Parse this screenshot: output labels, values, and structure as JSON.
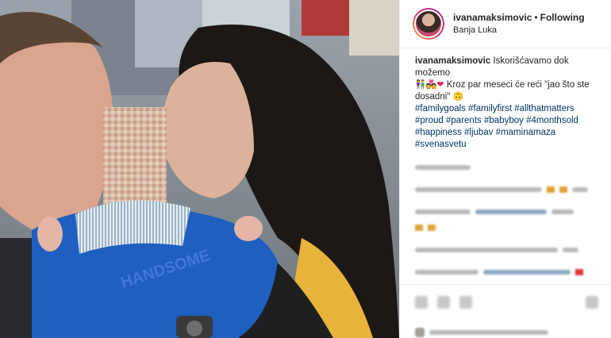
{
  "header": {
    "username": "ivanamaksimovic",
    "separator": "•",
    "follow_status": "Following",
    "location": "Banja Luka"
  },
  "caption": {
    "username": "ivanamaksimovic",
    "line1": "Iskorišćavamo dok možemo",
    "line2": "Kroz par meseci će reći \"jao što ste dosadni\"",
    "hashtags": [
      "#familygoals",
      "#familyfirst",
      "#allthatmatters",
      "#proud",
      "#parents",
      "#babyboy",
      "#4monthsold",
      "#happiness",
      "#ljubav",
      "#maminamaza",
      "#svenasvetu"
    ]
  },
  "photo": {
    "shirt_text": "HANDSOME"
  },
  "colors": {
    "link": "#003569",
    "text": "#262626",
    "border": "#efefef"
  }
}
